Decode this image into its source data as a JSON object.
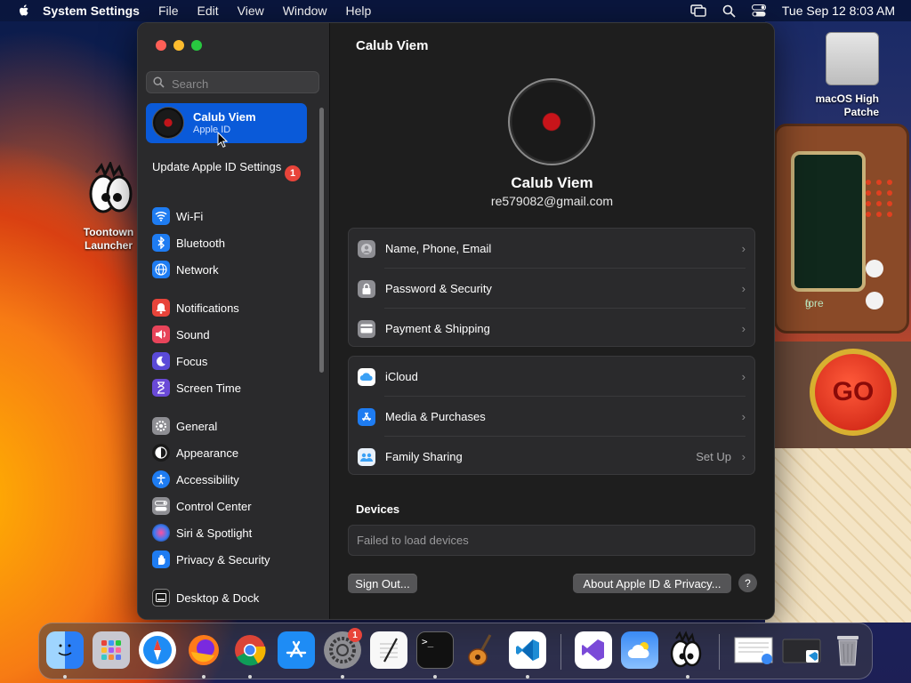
{
  "menubar": {
    "app_name": "System Settings",
    "menus": [
      "File",
      "Edit",
      "View",
      "Window",
      "Help"
    ],
    "clock": "Tue Sep 12  8:03 AM"
  },
  "desktop": {
    "drive_label_line1": "macOS High",
    "drive_label_line2": "Patche",
    "toontown_line1": "Toontown",
    "toontown_line2": "Launcher",
    "screen_text_line1": "g",
    "screen_text_line2": "fore",
    "go_label": "GO"
  },
  "sidebar": {
    "search_placeholder": "Search",
    "account": {
      "name": "Calub Viem",
      "subtitle": "Apple ID"
    },
    "update": {
      "label": "Update Apple ID Settings",
      "badge": "1"
    },
    "items": [
      {
        "label": "Wi-Fi",
        "icon": "wifi-icon",
        "color": "#1e7cf2"
      },
      {
        "label": "Bluetooth",
        "icon": "bluetooth-icon",
        "color": "#1e7cf2"
      },
      {
        "label": "Network",
        "icon": "globe-icon",
        "color": "#1e7cf2"
      },
      {
        "label": "Notifications",
        "icon": "bell-icon",
        "color": "#e8443a"
      },
      {
        "label": "Sound",
        "icon": "speaker-icon",
        "color": "#e8445a"
      },
      {
        "label": "Focus",
        "icon": "moon-icon",
        "color": "#5a4ad8"
      },
      {
        "label": "Screen Time",
        "icon": "hourglass-icon",
        "color": "#6a4ad8"
      },
      {
        "label": "General",
        "icon": "gear-icon",
        "color": "#8e8e93"
      },
      {
        "label": "Appearance",
        "icon": "appearance-icon",
        "color": "#1a1a1a"
      },
      {
        "label": "Accessibility",
        "icon": "accessibility-icon",
        "color": "#1e7cf2"
      },
      {
        "label": "Control Center",
        "icon": "control-center-icon",
        "color": "#8e8e93"
      },
      {
        "label": "Siri & Spotlight",
        "icon": "siri-icon",
        "color": "#3a2a6a"
      },
      {
        "label": "Privacy & Security",
        "icon": "hand-icon",
        "color": "#1e7cf2"
      },
      {
        "label": "Desktop & Dock",
        "icon": "dock-icon",
        "color": "#1a1a1a"
      }
    ]
  },
  "main": {
    "title": "Calub Viem",
    "profile_name": "Calub Viem",
    "email": "re579082@gmail.com",
    "group1": [
      {
        "label": "Name, Phone, Email",
        "icon": "person-icon"
      },
      {
        "label": "Password & Security",
        "icon": "lock-icon"
      },
      {
        "label": "Payment & Shipping",
        "icon": "card-icon"
      }
    ],
    "group2": [
      {
        "label": "iCloud",
        "icon": "icloud-icon",
        "extra": ""
      },
      {
        "label": "Media & Purchases",
        "icon": "app-store-icon",
        "extra": ""
      },
      {
        "label": "Family Sharing",
        "icon": "family-icon",
        "extra": "Set Up"
      }
    ],
    "devices_heading": "Devices",
    "devices_message": "Failed to load devices",
    "sign_out": "Sign Out...",
    "about": "About Apple ID & Privacy...",
    "help": "?"
  },
  "dock": {
    "apps": [
      "Finder",
      "Launchpad",
      "Safari",
      "Firefox",
      "Chrome",
      "App Store",
      "System Settings",
      "TextEdit",
      "Terminal",
      "GarageBand",
      "Visual Studio Code",
      "Visual Studio",
      "Weather",
      "Toontown Launcher",
      "Preview",
      "Downloads",
      "Trash"
    ],
    "settings_badge": "1"
  }
}
